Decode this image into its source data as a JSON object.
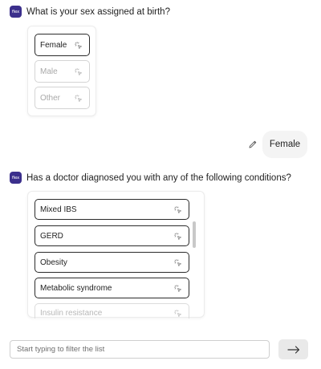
{
  "bot_badge_label": "flex",
  "question1": {
    "text": "What is your sex assigned at birth?",
    "options": [
      {
        "label": "Female",
        "state": "selected"
      },
      {
        "label": "Male",
        "state": "unselected"
      },
      {
        "label": "Other",
        "state": "unselected"
      }
    ]
  },
  "user_reply": {
    "text": "Female",
    "edit_icon": "pencil-icon"
  },
  "question2": {
    "text": "Has a doctor diagnosed you with any of the following conditions?",
    "options": [
      {
        "label": "Mixed IBS"
      },
      {
        "label": "GERD"
      },
      {
        "label": "Obesity"
      },
      {
        "label": "Metabolic syndrome"
      },
      {
        "label": "Insulin resistance"
      }
    ]
  },
  "footer": {
    "filter_placeholder": "Start typing to filter the list",
    "send_icon": "arrow-right-icon"
  },
  "colors": {
    "badge": "#3b2f8c",
    "selected_border": "#2b2b2b",
    "unselected_border": "#d4d4d4",
    "bubble_bg": "#f4f4f4",
    "send_bg": "#e9e9e9"
  }
}
